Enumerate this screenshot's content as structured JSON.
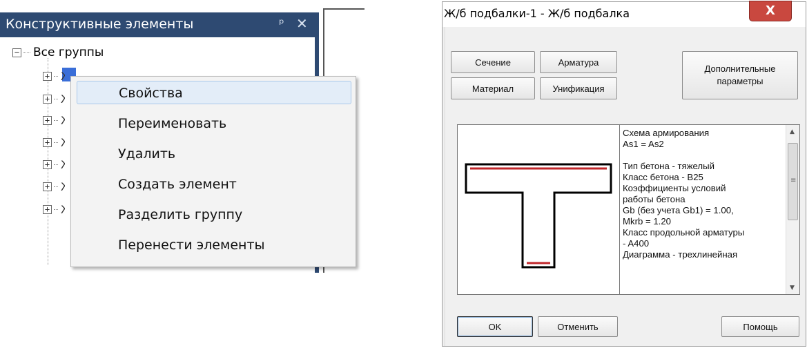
{
  "panel": {
    "title": "Конструктивные элементы",
    "pin_glyph": "ᵖ",
    "close_glyph": "✕",
    "root_toggle": "−",
    "root_label": "Все группы",
    "item_toggle": "+",
    "items": [
      "Ж",
      "Ж",
      "Ж",
      "Ж",
      "Ж",
      "Ж",
      "Ж"
    ]
  },
  "context_menu": {
    "items": [
      "Свойства",
      "Переименовать",
      "Удалить",
      "Создать элемент",
      "Разделить группу",
      "Перенести элементы"
    ]
  },
  "dialog": {
    "title": "Ж/б подбалки-1 - Ж/б подбалка",
    "close_glyph": "X",
    "buttons": {
      "section": "Сечение",
      "rebar": "Арматура",
      "material": "Материал",
      "unification": "Унификация",
      "additional_line1": "Дополнительные",
      "additional_line2": "параметры",
      "ok": "OK",
      "cancel": "Отменить",
      "help": "Помощь"
    },
    "description": [
      "Схема армирования",
      "As1 = As2",
      "",
      "Тип бетона - тяжелый",
      "Класс бетона - B25",
      "Коэффициенты условий",
      "работы бетона",
      "Gb (без учета Gb1) = 1.00,",
      "Mkrb = 1.20",
      "Класс продольной арматуры",
      "- A400",
      "Диаграмма - трехлинейная"
    ],
    "scroll": {
      "up": "▲",
      "down": "▼",
      "grip": "≡"
    },
    "colors": {
      "rebar": "#c0262a",
      "section_outline": "#000000",
      "close_button": "#c9483f",
      "panel_header": "#2e4a72"
    }
  }
}
